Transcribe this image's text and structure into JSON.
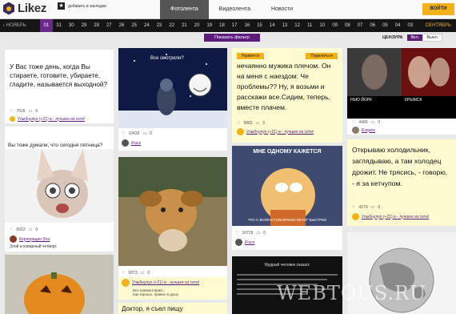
{
  "header": {
    "logo": "Likez",
    "bookmark": "добавить в закладки",
    "tabs": [
      "Фотолента",
      "Видеолента",
      "Новости"
    ],
    "active_tab": 0,
    "enter_button": "ВОЙТИ"
  },
  "dates": {
    "prev": "НОЯБРЬ",
    "days": [
      "01",
      "31",
      "30",
      "29",
      "28",
      "27",
      "26",
      "25",
      "24",
      "23",
      "22",
      "21",
      "20",
      "19",
      "18",
      "17",
      "16",
      "15",
      "14",
      "13",
      "12",
      "11",
      "10",
      "09",
      "08",
      "07",
      "06",
      "05",
      "04",
      "03"
    ],
    "active": 0,
    "next": "СЕНТЯБРЬ"
  },
  "filter": {
    "button": "Показать фильтр",
    "censor_label": "ЦЕНЗУРА",
    "on": "Вкл.",
    "off": "Выкл."
  },
  "cards": {
    "c1": {
      "text": "У Вас тоже день, когда Вы стираете, готовите, убираете, гладите, называется выходной?",
      "likes": "7526",
      "comments": "0",
      "link": "Улыбнулуо (+21) в - лучшее из сети!"
    },
    "c2": {
      "title": "Вы тоже думали, что сегодня пятница?",
      "likes": "6652",
      "comments": "0",
      "author": "Корпорация Зла",
      "subtitle": "Злой и коварный четверг."
    },
    "c3": {
      "caption": "Все смотрели?",
      "likes": "10432",
      "comments": "0",
      "author": "iFace"
    },
    "c4": {
      "likes": "6873",
      "comments": "0",
      "author": "Улыбнулуо (+21) в - лучшее из сети!",
      "note1": "Все комментарии...",
      "note2": "Как хорошо, правно в душу"
    },
    "c5": {
      "text": "Доктор, я съел пищу"
    },
    "c6": {
      "btn1": "Нравится",
      "btn2": "Поделиться",
      "text": "нечаянно мужика плечом. Он на меня с наездом: Че проблемы?? Ну, я возьми и расскажи все.Сидим, теперь, вместе плачем.",
      "likes": "5882",
      "comments": "0",
      "link": "Улыбнулуо (+21) в - лучшее из сети!"
    },
    "c7": {
      "caption": "МНЕ ОДНОМУ КАЖЕТСЯ",
      "caption2": "ЧТО С ВОЗРАСТОМ ВРЕМЯ ЛЕТИТ БЫСТРЕЕ",
      "likes": "10729",
      "comments": "0",
      "author": "iFace"
    },
    "c8": {
      "title": "Мудрый человек сказал:"
    },
    "c9": {
      "cap1": "НЬЮ ЙОРК",
      "cap2": "КРЫМСК",
      "likes": "4496",
      "comments": "0",
      "author": "Esquire"
    },
    "c10": {
      "text": "Открываю холодильник, заглядываю, а там холодец дрожит. Не трясись, - говорю, - я за кетчупом.",
      "likes": "4279",
      "comments": "0",
      "link": "Улыбнулуо (+21) в - лучшее из сети!"
    }
  },
  "watermark": "WEBTOUS.RU"
}
